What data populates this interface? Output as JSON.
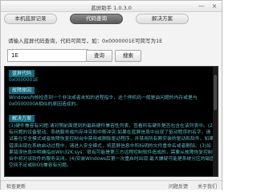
{
  "window": {
    "title": "蓝屏助手 1.0.3.0",
    "minimize_glyph": "—",
    "close_glyph": "×"
  },
  "tabs": [
    {
      "label": "本机蓝屏记录",
      "active": false
    },
    {
      "label": "代码查询",
      "active": true
    },
    {
      "label": "解决方案",
      "active": false
    }
  ],
  "query": {
    "prompt": "请输入蓝屏代码查询，代码可简写，如：0x0000001E可简写为1E",
    "code_value": "1E",
    "query_button": "查询",
    "search_button": "搜索"
  },
  "result": {
    "code_label": "蓝屏代码",
    "code": "0x0000001E",
    "cause_label": "故障原因",
    "cause_text": "Windows内核检查到一个非法或者未知的进程指令，这个停机码一般是由问题的内存或是与0x0000000A相似的原因造成的。",
    "solution_label": "解决方案",
    "solution_text": "(1)硬件兼容有问题:请对照前面提到的最新硬件兼容性列表，查看所有硬件是否包含在该列表中。(2)有问题的设备驱动、系统服务或内存冲突和中断冲突:如果在蓝屏信息中出现了驱动程序的名字，请试着在安全模式或者故障恢复控制台中禁用或删除驱动程序，并禁用所有刚安装的驱动和软件。如果错误出现在系统启动过程中，请进入安全模式，将蓝屏信息中所标明的文件重命名或者删除。(3)如果错误信息中明确指出Win32K.sys：很有可能是第三方远程控制软件造成的，需要从故障恢复控制台中将对该软件的服务关闭。(4)安装Windows后第一次重启时出现:最大嫌疑可能是系统分区的磁盘空间不足或BIOS兼容有问题。"
  },
  "footer": {
    "check_update": "检查更新",
    "feedback": "问题反馈",
    "about": "关于我们"
  }
}
